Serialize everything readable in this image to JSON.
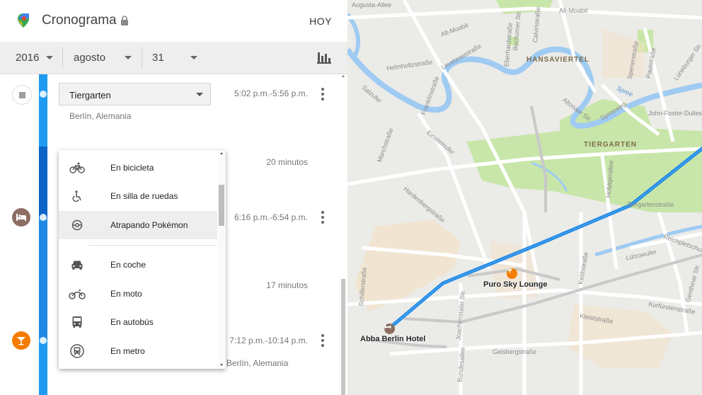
{
  "header": {
    "title": "Cronograma",
    "today_label": "HOY"
  },
  "date": {
    "year": "2016",
    "month": "agosto",
    "day": "31"
  },
  "timeline": {
    "place1": {
      "name": "Tiergarten",
      "location": "Berlín, Alemania",
      "time": "5:02 p.m.-5:56 p.m."
    },
    "move1": {
      "duration": "20 minutos"
    },
    "place2": {
      "time": "6:16 p.m.-6:54 p.m."
    },
    "move2": {
      "duration": "17 minutos"
    },
    "place3": {
      "time": "7:12 p.m.-10:14 p.m.",
      "location": "Berlín, Alemania"
    }
  },
  "activity_menu": {
    "items": [
      {
        "label": "En bicicleta",
        "icon": "bicycle-icon"
      },
      {
        "label": "En silla de ruedas",
        "icon": "wheelchair-icon"
      },
      {
        "label": "Atrapando Pokémon",
        "icon": "pokeball-icon",
        "selected": true
      },
      {
        "label": "En coche",
        "icon": "car-icon"
      },
      {
        "label": "En moto",
        "icon": "motorcycle-icon"
      },
      {
        "label": "En autobús",
        "icon": "bus-icon"
      },
      {
        "label": "En metro",
        "icon": "subway-icon"
      }
    ]
  },
  "map": {
    "districts": [
      "HANSAVIERTEL",
      "TIERGARTEN"
    ],
    "streets": [
      "Augusta-Allee",
      "Alt-Moabit",
      "Alt-Moabit",
      "Levetzowstraße",
      "Helmholtzstraße",
      "Franklinstraße",
      "Salzufer",
      "Marchstraße",
      "Einsteinufer",
      "Hardenbergstraße",
      "Altonaer Str.",
      "Spreeweg",
      "John-Foster-Dulles",
      "Paulstraße",
      "Spenerstraße",
      "Lüneburger Str.",
      "Tiergartenstraße",
      "Reichpietschufer",
      "Lützowufer",
      "Kleiststraße",
      "Kurfürstenstraße",
      "Geisbergstraße",
      "Schillerstraße",
      "Joachimstaler Str.",
      "Bundesallee",
      "Keithstraße",
      "Genthiner Str.",
      "Hofjägerallee",
      "Bochumer Str.",
      "Calvinstraße",
      "Eberhardstraße",
      "Spree"
    ],
    "pois": {
      "hotel": "Abba Berlin Hotel",
      "bar": "Puro Sky Lounge"
    },
    "colors": {
      "route": "#1e88e5",
      "park": "#c7e4a8",
      "water": "#9fcbf2",
      "accent": "#f57c00"
    }
  }
}
